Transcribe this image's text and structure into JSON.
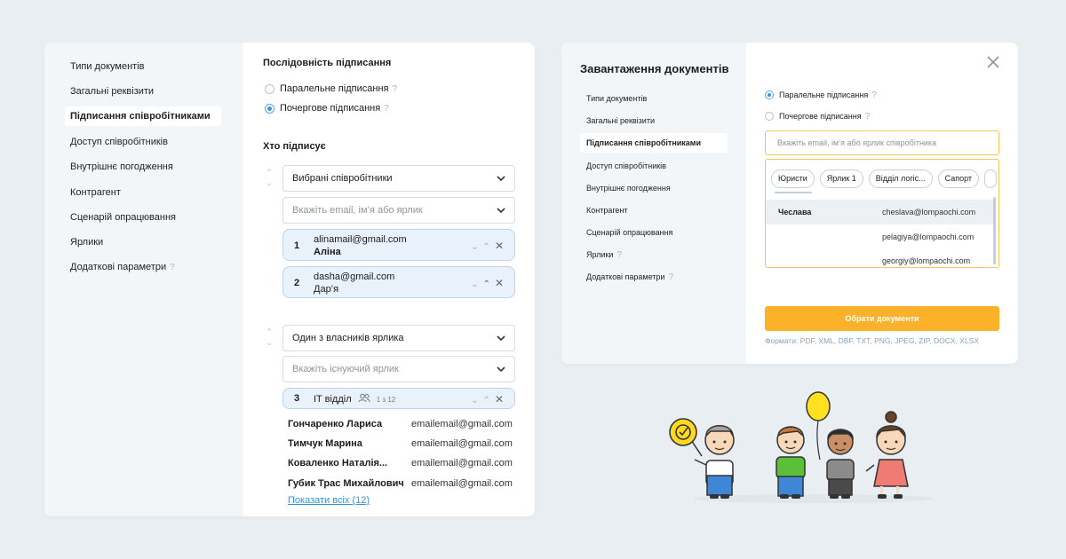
{
  "left_panel": {
    "sidebar": [
      {
        "label": "Типи документів"
      },
      {
        "label": "Загальні реквізити"
      },
      {
        "label": "Підписання співробітниками",
        "active": true
      },
      {
        "label": "Доступ співробітників"
      },
      {
        "label": "Внутрішнє погодження"
      },
      {
        "label": "Контрагент"
      },
      {
        "label": "Сценарій опрацювання"
      },
      {
        "label": "Ярлики"
      },
      {
        "label": "Додаткові параметри",
        "help": "?"
      }
    ],
    "sequence_heading": "Послідовність підписання",
    "radios": [
      {
        "label": "Паралельне підписання",
        "help": "?",
        "selected": false
      },
      {
        "label": "Почергове підписання",
        "help": "?",
        "selected": true
      }
    ],
    "who_heading": "Хто підписує",
    "group1": {
      "select": "Вибрані співробітники",
      "search_placeholder": "Вкажіть email, ім’я або ярлик",
      "signers": [
        {
          "num": "1",
          "email": "alinamail@gmail.com",
          "name": "Аліна"
        },
        {
          "num": "2",
          "email": "dasha@gmail.com",
          "name": "Дар’я"
        }
      ]
    },
    "group2": {
      "select": "Один з власників ярлика",
      "search_placeholder": "Вкажіть існуючий ярлик",
      "label_card": {
        "num": "3",
        "name": "IT відділ",
        "count": "1 з 12"
      },
      "people": [
        {
          "name": "Гончаренко Лариса",
          "email": "emailemail@gmail.com"
        },
        {
          "name": "Тимчук Марина",
          "email": "emailemail@gmail.com"
        },
        {
          "name": "Коваленко Наталія...",
          "email": "emailemail@gmail.com"
        },
        {
          "name": "Губик Трас Михайлович",
          "email": "emailemail@gmail.com"
        }
      ],
      "show_all": "Показати всіх (12)"
    }
  },
  "right_panel": {
    "title": "Завантаження документів",
    "sidebar": [
      {
        "label": "Типи документів"
      },
      {
        "label": "Загальні реквізити"
      },
      {
        "label": "Підписання співробітниками",
        "active": true
      },
      {
        "label": "Доступ співробітників"
      },
      {
        "label": "Внутрішнє погодження"
      },
      {
        "label": "Контрагент"
      },
      {
        "label": "Сценарій опрацювання"
      },
      {
        "label": "Ярлики",
        "help": "?"
      },
      {
        "label": "Додаткові параметри",
        "help": "?"
      }
    ],
    "radios": [
      {
        "label": "Паралельне підписання",
        "help": "?",
        "selected": true
      },
      {
        "label": "Почергове підписання",
        "help": "?",
        "selected": false
      }
    ],
    "search_placeholder": "Вкажіть email, ім’я або ярлик співробітника",
    "chips": [
      "Юристи",
      "Ярлик 1",
      "Відділ логіс...",
      "Сапорт"
    ],
    "dropdown_rows": [
      {
        "name": "Чеслава",
        "email": "cheslava@lompaochi.com",
        "highlighted": true
      },
      {
        "name": "",
        "email": "pelagiya@lompaochi.com"
      },
      {
        "name": "",
        "email": "georgiy@lompaochi.com"
      }
    ],
    "button": "Обрати документи",
    "formats": "Формати: PDF, XML, DBF, TXT, PNG, JPEG, ZIP, DOCX, XLSX"
  },
  "colors": {
    "background": "#e9eef3",
    "sidebar": "#f3f6f9",
    "accent_blue": "#3f8fe0",
    "card_bg": "#e9f1fb",
    "button_yellow": "#fcb12a",
    "link": "#2e96d8"
  },
  "icons": {
    "chevron": "chevron-down-icon",
    "close": "close-icon",
    "group": "group-icon",
    "help": "question-icon"
  }
}
